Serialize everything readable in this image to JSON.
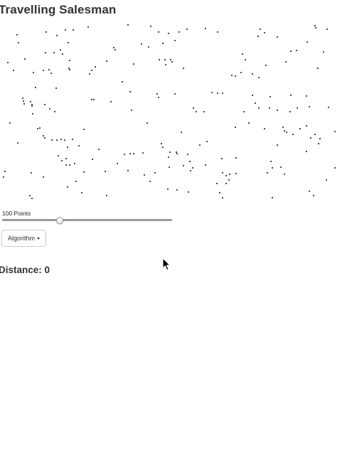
{
  "page": {
    "title": "Travelling Salesman"
  },
  "points_control": {
    "label": "100 Points",
    "value": 100,
    "min": 0,
    "max": 300
  },
  "algorithm_dropdown": {
    "label": "Algorithm"
  },
  "distance": {
    "label": "Distance: 0",
    "value": 0
  },
  "icons": {
    "dropdown": "caret-down-icon",
    "cursor": "mouse-pointer-icon"
  },
  "colors": {
    "point": "#111111",
    "text": "#333333",
    "track": "#a8a8a8"
  },
  "points_plot": {
    "x_range": [
      0,
      480
    ],
    "y_range": [
      0,
      266
    ],
    "points": [
      [
        24,
        23
      ],
      [
        65,
        19
      ],
      [
        80,
        24
      ],
      [
        92,
        16
      ],
      [
        103,
        16
      ],
      [
        124,
        12
      ],
      [
        180,
        9
      ],
      [
        212,
        11
      ],
      [
        223,
        19
      ],
      [
        237,
        21
      ],
      [
        252,
        19
      ],
      [
        263,
        15
      ],
      [
        289,
        14
      ],
      [
        306,
        19
      ],
      [
        366,
        15
      ],
      [
        372,
        20
      ],
      [
        363,
        25
      ],
      [
        390,
        26
      ],
      [
        443,
        10
      ],
      [
        444,
        13
      ],
      [
        460,
        15
      ],
      [
        26,
        34
      ],
      [
        85,
        44
      ],
      [
        96,
        34
      ],
      [
        160,
        41
      ],
      [
        162,
        44
      ],
      [
        199,
        36
      ],
      [
        209,
        40
      ],
      [
        229,
        35
      ],
      [
        246,
        31
      ],
      [
        409,
        46
      ],
      [
        417,
        45
      ],
      [
        432,
        33
      ],
      [
        455,
        47
      ],
      [
        11,
        62
      ],
      [
        35,
        57
      ],
      [
        64,
        48
      ],
      [
        76,
        48
      ],
      [
        88,
        50
      ],
      [
        98,
        59
      ],
      [
        134,
        68
      ],
      [
        150,
        60
      ],
      [
        188,
        64
      ],
      [
        224,
        58
      ],
      [
        232,
        58
      ],
      [
        240,
        58
      ],
      [
        233,
        65
      ],
      [
        242,
        61
      ],
      [
        258,
        70
      ],
      [
        341,
        50
      ],
      [
        345,
        58
      ],
      [
        374,
        66
      ],
      [
        402,
        61
      ],
      [
        447,
        70
      ],
      [
        19,
        73
      ],
      [
        47,
        76
      ],
      [
        61,
        73
      ],
      [
        69,
        72
      ],
      [
        72,
        77
      ],
      [
        97,
        70
      ],
      [
        98,
        72
      ],
      [
        126,
        78
      ],
      [
        129,
        73
      ],
      [
        326,
        80
      ],
      [
        331,
        81
      ],
      [
        339,
        76
      ],
      [
        355,
        78
      ],
      [
        364,
        83
      ],
      [
        172,
        89
      ],
      [
        50,
        97
      ],
      [
        79,
        98
      ],
      [
        32,
        112
      ],
      [
        33,
        116
      ],
      [
        34,
        120
      ],
      [
        43,
        117
      ],
      [
        45,
        121
      ],
      [
        45,
        123
      ],
      [
        63,
        121
      ],
      [
        129,
        114
      ],
      [
        132,
        114
      ],
      [
        156,
        117
      ],
      [
        183,
        103
      ],
      [
        221,
        106
      ],
      [
        223,
        111
      ],
      [
        246,
        106
      ],
      [
        298,
        104
      ],
      [
        306,
        105
      ],
      [
        313,
        105
      ],
      [
        355,
        108
      ],
      [
        380,
        110
      ],
      [
        409,
        108
      ],
      [
        431,
        109
      ],
      [
        435,
        124
      ],
      [
        14,
        147
      ],
      [
        46,
        134
      ],
      [
        70,
        127
      ],
      [
        77,
        131
      ],
      [
        185,
        129
      ],
      [
        272,
        126
      ],
      [
        276,
        131
      ],
      [
        287,
        131
      ],
      [
        343,
        131
      ],
      [
        359,
        119
      ],
      [
        364,
        126
      ],
      [
        379,
        126
      ],
      [
        390,
        129
      ],
      [
        408,
        131
      ],
      [
        418,
        126
      ],
      [
        462,
        125
      ],
      [
        53,
        155
      ],
      [
        56,
        154
      ],
      [
        118,
        156
      ],
      [
        207,
        147
      ],
      [
        350,
        147
      ],
      [
        331,
        153
      ],
      [
        372,
        155
      ],
      [
        398,
        153
      ],
      [
        403,
        160
      ],
      [
        422,
        155
      ],
      [
        431,
        151
      ],
      [
        471,
        159
      ],
      [
        61,
        165
      ],
      [
        63,
        168
      ],
      [
        73,
        171
      ],
      [
        80,
        171
      ],
      [
        86,
        170
      ],
      [
        91,
        171
      ],
      [
        102,
        170
      ],
      [
        255,
        160
      ],
      [
        291,
        173
      ],
      [
        281,
        178
      ],
      [
        400,
        158
      ],
      [
        412,
        163
      ],
      [
        437,
        168
      ],
      [
        443,
        163
      ],
      [
        450,
        169
      ],
      [
        448,
        176
      ],
      [
        431,
        187
      ],
      [
        25,
        175
      ],
      [
        95,
        181
      ],
      [
        111,
        179
      ],
      [
        139,
        184
      ],
      [
        201,
        189
      ],
      [
        227,
        176
      ],
      [
        229,
        181
      ],
      [
        239,
        188
      ],
      [
        249,
        190
      ],
      [
        264,
        191
      ],
      [
        312,
        197
      ],
      [
        390,
        178
      ],
      [
        82,
        193
      ],
      [
        87,
        200
      ],
      [
        93,
        197
      ],
      [
        93,
        206
      ],
      [
        98,
        206
      ],
      [
        105,
        204
      ],
      [
        130,
        198
      ],
      [
        165,
        204
      ],
      [
        175,
        191
      ],
      [
        183,
        190
      ],
      [
        188,
        190
      ],
      [
        237,
        195
      ],
      [
        248,
        188
      ],
      [
        267,
        201
      ],
      [
        289,
        206
      ],
      [
        332,
        196
      ],
      [
        381,
        201
      ],
      [
        383,
        210
      ],
      [
        395,
        209
      ],
      [
        313,
        217
      ],
      [
        323,
        219
      ],
      [
        7,
        215
      ],
      [
        5,
        223
      ],
      [
        44,
        217
      ],
      [
        61,
        223
      ],
      [
        118,
        216
      ],
      [
        148,
        215
      ],
      [
        180,
        214
      ],
      [
        203,
        220
      ],
      [
        218,
        217
      ],
      [
        238,
        209
      ],
      [
        258,
        207
      ],
      [
        268,
        214
      ],
      [
        271,
        210
      ],
      [
        318,
        221
      ],
      [
        332,
        218
      ],
      [
        376,
        217
      ],
      [
        400,
        219
      ],
      [
        459,
        227
      ],
      [
        471,
        210
      ],
      [
        95,
        237
      ],
      [
        107,
        229
      ],
      [
        115,
        245
      ],
      [
        150,
        249
      ],
      [
        211,
        229
      ],
      [
        236,
        240
      ],
      [
        249,
        241
      ],
      [
        265,
        244
      ],
      [
        305,
        232
      ],
      [
        318,
        232
      ],
      [
        322,
        227
      ],
      [
        309,
        245
      ],
      [
        313,
        252
      ],
      [
        435,
        243
      ],
      [
        441,
        249
      ],
      [
        42,
        249
      ],
      [
        45,
        253
      ],
      [
        383,
        252
      ]
    ]
  }
}
